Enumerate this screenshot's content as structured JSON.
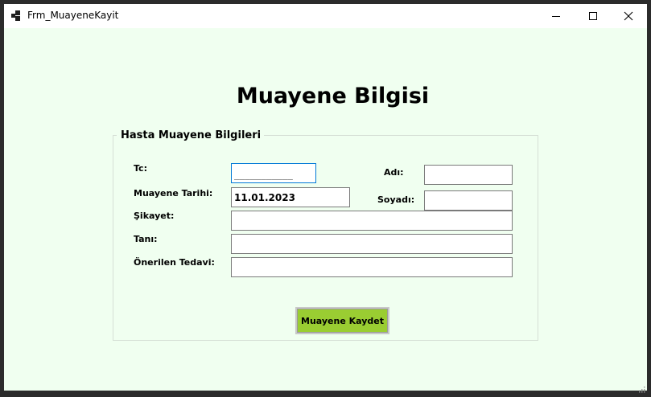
{
  "window": {
    "title": "Frm_MuayeneKayit",
    "icon": "app-form-icon",
    "controls": [
      "minimize-icon",
      "maximize-icon",
      "close-icon"
    ]
  },
  "form": {
    "heading": "Muayene Bilgisi",
    "group_title": "Hasta Muayene Bilgileri",
    "labels": {
      "tc": "Tc:",
      "ad": "Adı:",
      "muayene_tarihi": "Muayene Tarihi:",
      "soyad": "Soyadı:",
      "sikayet": "Şikayet:",
      "tani": "Tanı:",
      "onerilen_tedavi": "Önerilen Tedavi:"
    },
    "values": {
      "tc": "___________",
      "ad": "",
      "muayene_tarihi": "11.01.2023",
      "soyad": "",
      "sikayet": "",
      "tani": "",
      "onerilen_tedavi": ""
    },
    "save_button": "Muayene Kaydet"
  },
  "colors": {
    "form_background": "#f0fff0",
    "button_background": "#9acd32",
    "focus_border": "#0078d7"
  }
}
